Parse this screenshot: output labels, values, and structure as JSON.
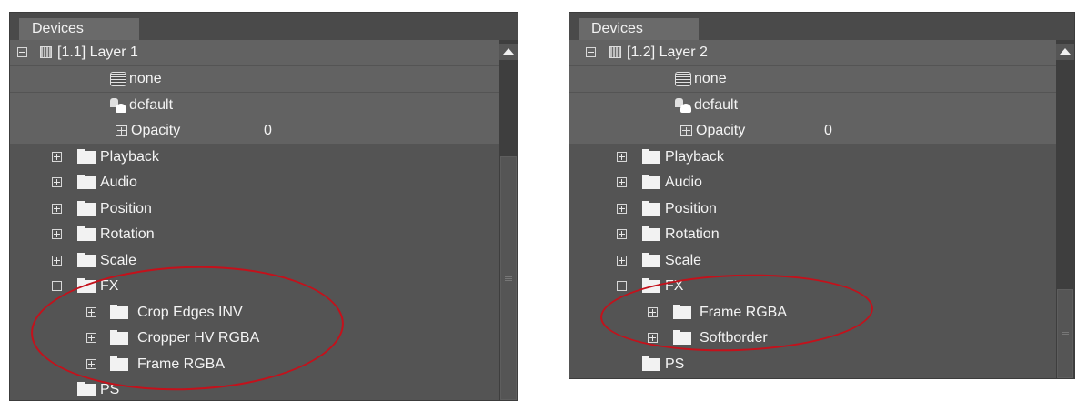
{
  "panels": [
    {
      "tab": "Devices",
      "root": {
        "label": "[1.1] Layer 1"
      },
      "none_label": "none",
      "default_label": "default",
      "opacity": {
        "label": "Opacity",
        "value": "0"
      },
      "groups": [
        "Playback",
        "Audio",
        "Position",
        "Rotation",
        "Scale",
        "FX"
      ],
      "fx_children": [
        "Crop Edges INV",
        "Cropper HV RGBA",
        "Frame RGBA"
      ],
      "after": "PS"
    },
    {
      "tab": "Devices",
      "root": {
        "label": "[1.2] Layer 2"
      },
      "none_label": "none",
      "default_label": "default",
      "opacity": {
        "label": "Opacity",
        "value": "0"
      },
      "groups": [
        "Playback",
        "Audio",
        "Position",
        "Rotation",
        "Scale",
        "FX"
      ],
      "fx_children": [
        "Frame RGBA",
        "Softborder"
      ],
      "after": "PS"
    }
  ],
  "colors": {
    "panel_bg": "#545454",
    "highlight_row": "#626262",
    "annotation_ellipse": "#c4111b"
  },
  "icons": [
    "expand-collapse-icon",
    "layer-icon",
    "none-icon",
    "default-icon",
    "opacity-icon",
    "folder-icon",
    "scroll-up-icon"
  ]
}
